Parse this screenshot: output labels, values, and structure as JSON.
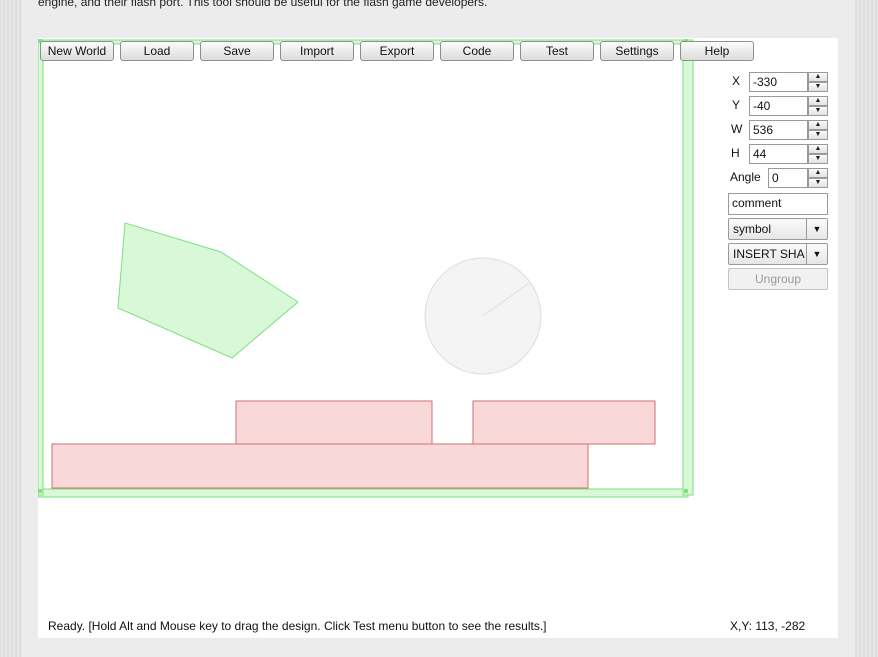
{
  "intro_text": "engine, and their flash port. This tool should be useful for the flash game developers.",
  "toolbar": {
    "buttons": [
      "New World",
      "Load",
      "Save",
      "Import",
      "Export",
      "Code",
      "Test",
      "Settings",
      "Help"
    ]
  },
  "props": {
    "x": {
      "label": "X",
      "value": "-330"
    },
    "y": {
      "label": "Y",
      "value": "-40"
    },
    "w": {
      "label": "W",
      "value": "536"
    },
    "h": {
      "label": "H",
      "value": "44"
    },
    "angle": {
      "label": "Angle",
      "value": "0"
    },
    "comment": "comment",
    "symbol_select": "symbol",
    "insert_shape_select": "INSERT SHAPE",
    "ungroup": "Ungroup"
  },
  "status": {
    "message": "Ready. [Hold Alt and Mouse key to drag the design. Click Test menu button to see the results.]",
    "coords": "X,Y: 113, -282"
  },
  "colors": {
    "selection_stroke": "#7ee07e",
    "selection_fill": "#d8f8d8",
    "box_fill": "#f8d8d8",
    "box_stroke": "#d07070",
    "circle_fill": "#f4f4f4",
    "circle_stroke": "#dddddd"
  }
}
